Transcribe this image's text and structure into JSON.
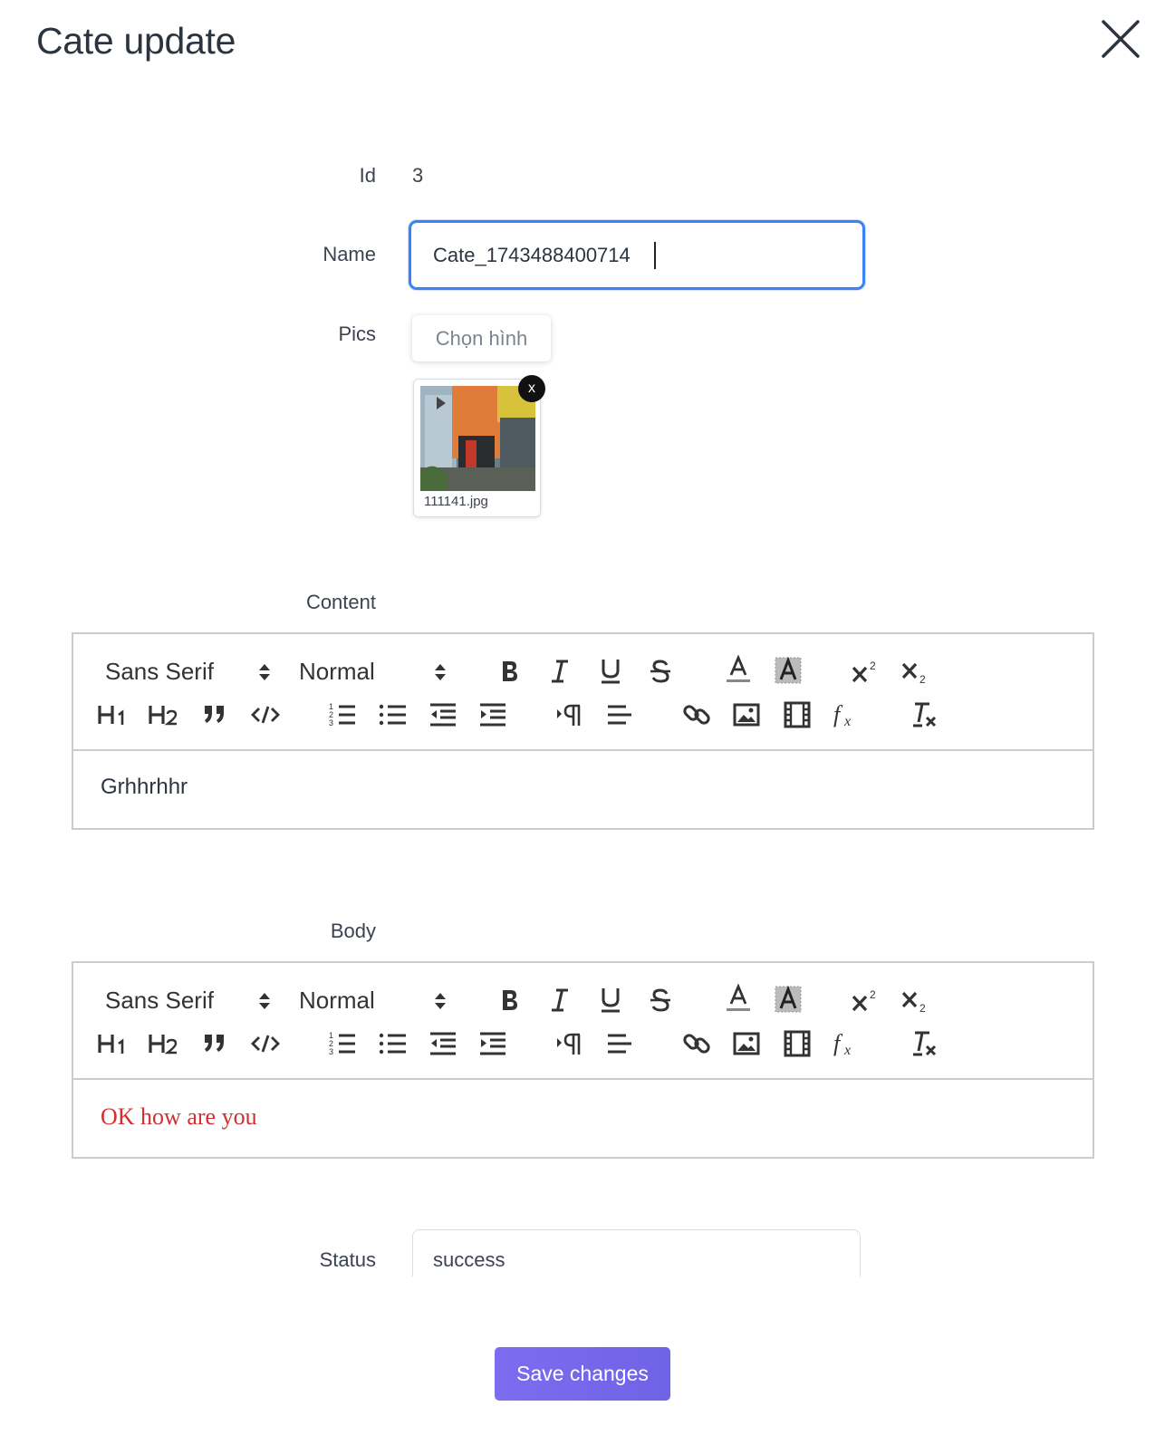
{
  "modal": {
    "title": "Cate update"
  },
  "form": {
    "id_label": "Id",
    "id_value": "3",
    "name_label": "Name",
    "name_value": "Cate_1743488400714",
    "pics_label": "Pics",
    "choose_button": "Chọn hình",
    "file_name": "111141.jpg",
    "remove_label": "x",
    "content_label": "Content",
    "body_label": "Body",
    "status_label": "Status",
    "status_value": "success"
  },
  "toolbar": {
    "font_picker": "Sans Serif",
    "size_picker": "Normal",
    "buttons": [
      "bold",
      "italic",
      "underline",
      "strike",
      "color",
      "background",
      "superscript",
      "subscript",
      "header-1",
      "header-2",
      "blockquote",
      "code-block",
      "ordered-list",
      "bullet-list",
      "outdent",
      "indent",
      "direction",
      "align",
      "link",
      "image",
      "video",
      "formula",
      "clean"
    ]
  },
  "editors": {
    "content_text": "Grhhrhhr",
    "body_text": "OK how are you",
    "body_text_color": "#d32f2f"
  },
  "actions": {
    "save": "Save changes"
  },
  "colors": {
    "accent": "#7063e8",
    "focus": "#3b82f6"
  }
}
